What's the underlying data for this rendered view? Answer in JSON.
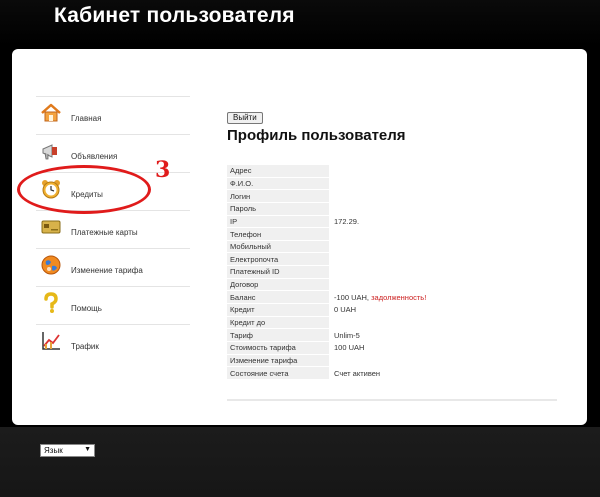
{
  "header": {
    "title": "Кабинет пользователя"
  },
  "sidebar": {
    "items": [
      {
        "label": "Главная",
        "icon": "home-icon"
      },
      {
        "label": "Объявления",
        "icon": "megaphone-icon"
      },
      {
        "label": "Кредиты",
        "icon": "alarm-clock-icon"
      },
      {
        "label": "Платежные карты",
        "icon": "payment-card-icon"
      },
      {
        "label": "Изменение тарифа",
        "icon": "globe-icon"
      },
      {
        "label": "Помощь",
        "icon": "question-icon"
      },
      {
        "label": "Трафик",
        "icon": "traffic-chart-icon"
      }
    ]
  },
  "annotation": {
    "number": "3",
    "color": "#e01b1b"
  },
  "content": {
    "logout_label": "Выйти",
    "title": "Профиль пользователя",
    "profile": [
      {
        "key": "Адрес",
        "value": ""
      },
      {
        "key": "Ф.И.О.",
        "value": ""
      },
      {
        "key": "Логин",
        "value": ""
      },
      {
        "key": "Пароль",
        "value": ""
      },
      {
        "key": "IP",
        "value": "172.29."
      },
      {
        "key": "Телефон",
        "value": ""
      },
      {
        "key": "Мобильный",
        "value": ""
      },
      {
        "key": "Електропочта",
        "value": ""
      },
      {
        "key": "Платежный ID",
        "value": ""
      },
      {
        "key": "Договор",
        "value": ""
      },
      {
        "key": "Баланс",
        "value": "-100 UAH,",
        "note": "задолженность!"
      },
      {
        "key": "Кредит",
        "value": "0 UAH"
      },
      {
        "key": "Кредит до",
        "value": ""
      },
      {
        "key": "Тариф",
        "value": "Unlim-5"
      },
      {
        "key": "Стоимость тарифа",
        "value": "100 UAH"
      },
      {
        "key": "Изменение тарифа",
        "value": ""
      },
      {
        "key": "Состояние счета",
        "value": "Счет активен"
      }
    ]
  },
  "footer": {
    "language_label": "Язык"
  },
  "colors": {
    "background": "#000000",
    "panel": "#ffffff",
    "debt": "#cc2020"
  }
}
